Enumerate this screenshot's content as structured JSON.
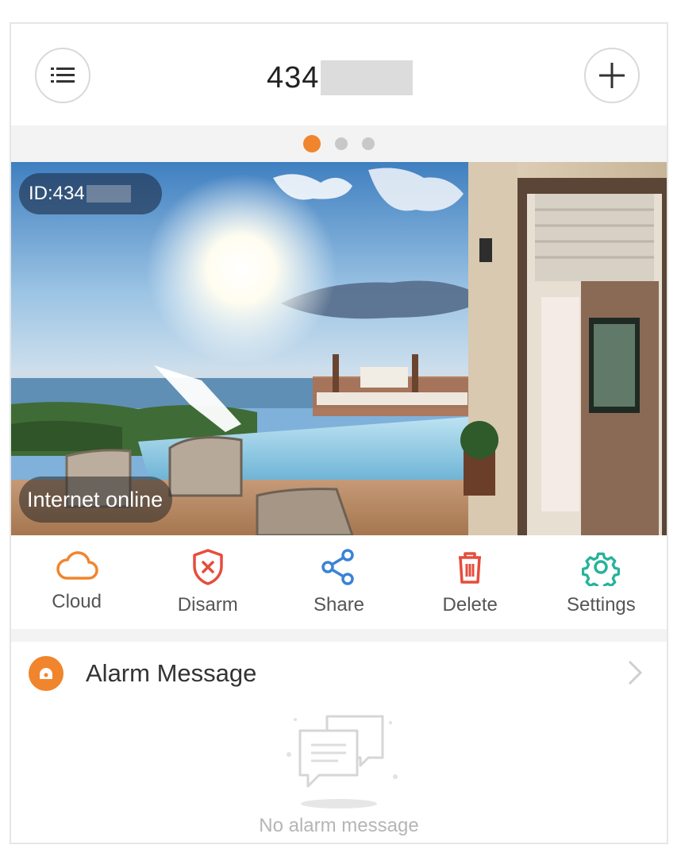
{
  "header": {
    "title_visible": "434",
    "menu_icon": "list-icon",
    "add_icon": "plus-icon"
  },
  "pager": {
    "count": 3,
    "active_index": 0,
    "active_color": "#f0852d"
  },
  "camera": {
    "id_label": "ID:434",
    "status": "Internet online"
  },
  "actions": [
    {
      "label": "Cloud",
      "icon": "cloud-icon",
      "color": "#f0852d"
    },
    {
      "label": "Disarm",
      "icon": "shield-x-icon",
      "color": "#e74c3c"
    },
    {
      "label": "Share",
      "icon": "share-icon",
      "color": "#3b82d6"
    },
    {
      "label": "Delete",
      "icon": "trash-icon",
      "color": "#e74c3c"
    },
    {
      "label": "Settings",
      "icon": "gear-icon",
      "color": "#26b39a"
    }
  ],
  "alarm": {
    "title": "Alarm Message",
    "empty_text": "No alarm message"
  }
}
